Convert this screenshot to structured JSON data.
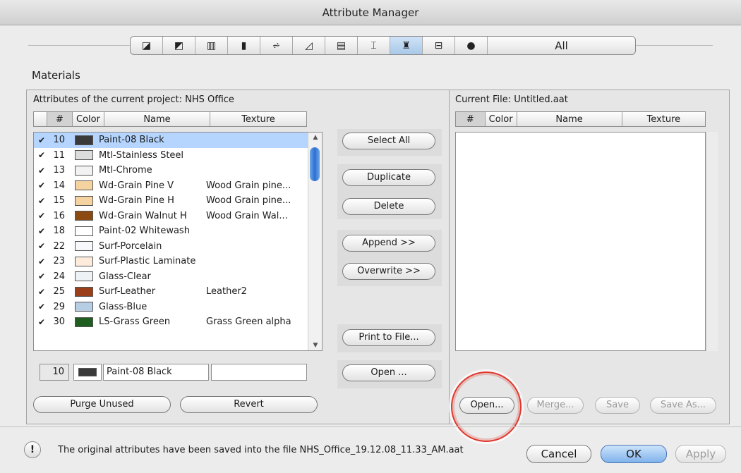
{
  "window": {
    "title": "Attribute Manager"
  },
  "toolbar": {
    "categories": [
      {
        "icon": "layers-icon",
        "glyph": "◪"
      },
      {
        "icon": "layer-combinations-icon",
        "glyph": "◩"
      },
      {
        "icon": "pens-icon",
        "glyph": "▥"
      },
      {
        "icon": "line-types-icon",
        "glyph": "▮"
      },
      {
        "icon": "fill-types-icon",
        "glyph": "⩫"
      },
      {
        "icon": "composites-icon",
        "glyph": "◿"
      },
      {
        "icon": "profiles-icon",
        "glyph": "▤"
      },
      {
        "icon": "zones-icon",
        "glyph": "⌶"
      },
      {
        "icon": "materials-icon",
        "glyph": "♜"
      },
      {
        "icon": "markup-styles-icon",
        "glyph": "⊟"
      },
      {
        "icon": "locations-icon",
        "glyph": "●"
      }
    ],
    "all_label": "All"
  },
  "materials_title": "Materials",
  "left": {
    "title": "Attributes of the current project: NHS Office",
    "columns": [
      "#",
      "Color",
      "Name",
      "Texture"
    ],
    "rows": [
      {
        "num": "10",
        "color": "#3a3a3a",
        "name": "Paint-08 Black",
        "texture": ""
      },
      {
        "num": "11",
        "color": "#dcdcdc",
        "name": "Mtl-Stainless Steel",
        "texture": ""
      },
      {
        "num": "13",
        "color": "#f2f2f2",
        "name": "Mtl-Chrome",
        "texture": ""
      },
      {
        "num": "14",
        "color": "#f5d3a0",
        "name": "Wd-Grain Pine V",
        "texture": "Wood Grain pine..."
      },
      {
        "num": "15",
        "color": "#f5d3a0",
        "name": "Wd-Grain Pine H",
        "texture": "Wood Grain pine..."
      },
      {
        "num": "16",
        "color": "#8b4a12",
        "name": "Wd-Grain Walnut H",
        "texture": "Wood Grain Wal..."
      },
      {
        "num": "18",
        "color": "#ffffff",
        "name": "Paint-02 Whitewash",
        "texture": ""
      },
      {
        "num": "22",
        "color": "#f6f8fb",
        "name": "Surf-Porcelain",
        "texture": ""
      },
      {
        "num": "23",
        "color": "#fdebdc",
        "name": "Surf-Plastic Laminate",
        "texture": ""
      },
      {
        "num": "24",
        "color": "#eef2f4",
        "name": "Glass-Clear",
        "texture": ""
      },
      {
        "num": "25",
        "color": "#9b3f1a",
        "name": "Surf-Leather",
        "texture": "Leather2"
      },
      {
        "num": "29",
        "color": "#b6cde4",
        "name": "Glass-Blue",
        "texture": ""
      },
      {
        "num": "30",
        "color": "#1f5e1f",
        "name": "LS-Grass Green",
        "texture": "Grass Green alpha"
      }
    ],
    "edit": {
      "num": "10",
      "color": "#3a3a3a",
      "name": "Paint-08 Black",
      "texture": ""
    },
    "purge_label": "Purge Unused",
    "revert_label": "Revert"
  },
  "middle": {
    "select_all": "Select All",
    "duplicate": "Duplicate",
    "delete": "Delete",
    "append": "Append >>",
    "overwrite": "Overwrite >>",
    "print_to_file": "Print to File...",
    "open": "Open ..."
  },
  "right": {
    "title": "Current File: Untitled.aat",
    "columns": [
      "#",
      "Color",
      "Name",
      "Texture"
    ],
    "open_label": "Open...",
    "merge_label": "Merge...",
    "save_label": "Save",
    "save_as_label": "Save As..."
  },
  "footer": {
    "message": "The original attributes have been saved into the file NHS_Office_19.12.08_11.33_AM.aat",
    "cancel": "Cancel",
    "ok": "OK",
    "apply": "Apply"
  }
}
